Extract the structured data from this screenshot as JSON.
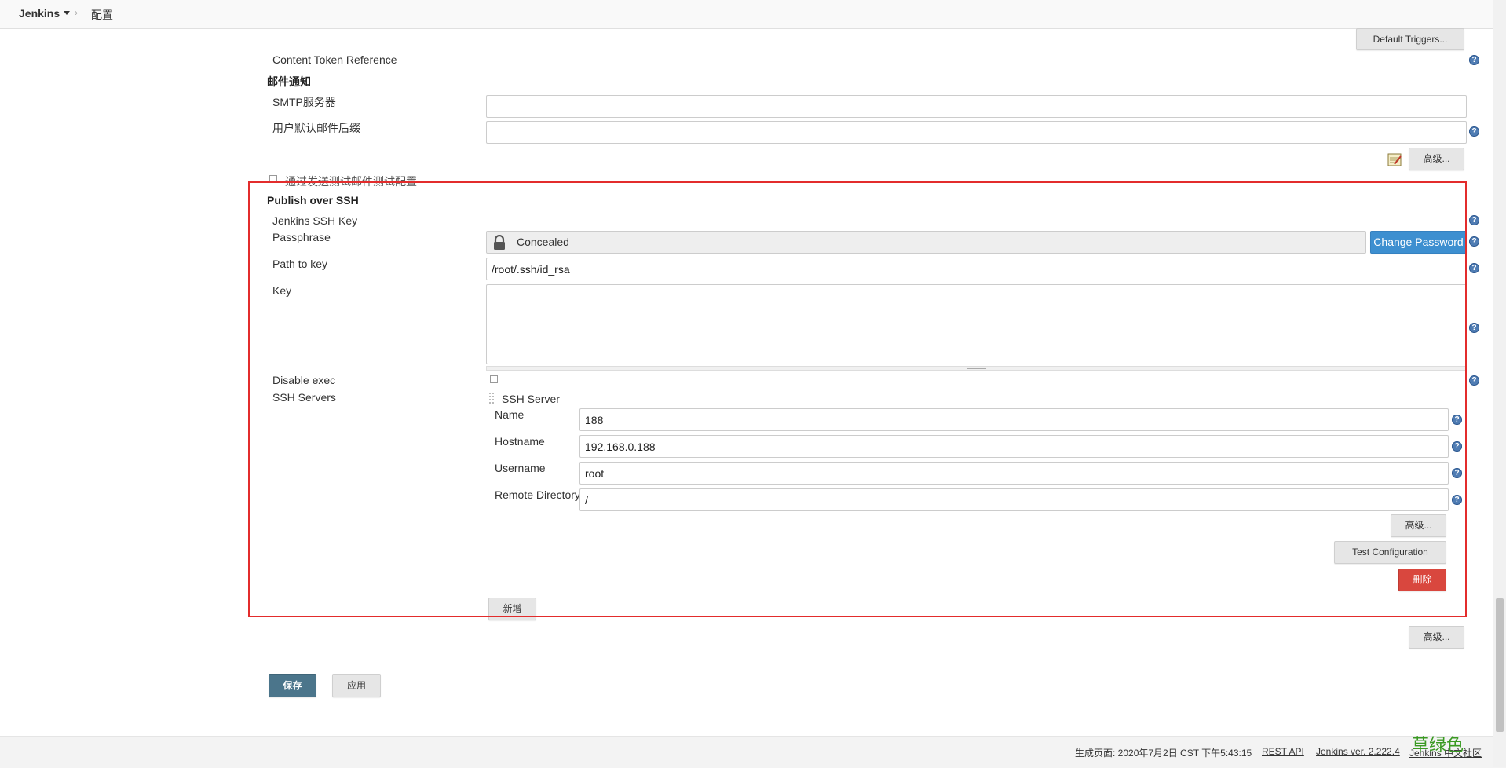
{
  "header": {
    "jenkins_label": "Jenkins",
    "separator": "›",
    "config_label": "配置"
  },
  "top": {
    "default_triggers_label": "Default Triggers...",
    "content_token_label": "Content Token Reference"
  },
  "mail": {
    "title": "邮件通知",
    "smtp_label": "SMTP服务器",
    "smtp_value": "",
    "suffix_label": "用户默认邮件后缀",
    "suffix_value": "",
    "advanced_label": "高级...",
    "test_label": "通过发送测试邮件测试配置"
  },
  "ssh": {
    "title": "Publish over SSH",
    "jenkins_key_label": "Jenkins SSH Key",
    "passphrase_label": "Passphrase",
    "concealed_label": "Concealed",
    "change_password_label": "Change Password",
    "path_label": "Path to key",
    "path_value": "/root/.ssh/id_rsa",
    "key_label": "Key",
    "key_value": "",
    "disable_exec_label": "Disable exec",
    "servers_label": "SSH Servers",
    "server": {
      "header": "SSH Server",
      "name_label": "Name",
      "name_value": "188",
      "hostname_label": "Hostname",
      "hostname_value": "192.168.0.188",
      "username_label": "Username",
      "username_value": "root",
      "remote_dir_label": "Remote Directory",
      "remote_dir_value": "/",
      "advanced_label": "高级...",
      "test_config_label": "Test Configuration",
      "delete_label": "删除"
    },
    "add_label": "新增"
  },
  "bottom": {
    "advanced_label": "高级...",
    "save_label": "保存",
    "apply_label": "应用"
  },
  "footer": {
    "generated": "生成页面: 2020年7月2日 CST 下午5:43:15",
    "rest_api": "REST API",
    "version": "Jenkins ver. 2.222.4",
    "community": "Jenkins 中文社区",
    "watermark": "草绿色"
  },
  "help_icon_glyph": "?",
  "colors": {
    "highlight": "#e32c2c",
    "change_password": "#3d8fd0",
    "delete": "#d9473e",
    "save": "#4b758b"
  }
}
